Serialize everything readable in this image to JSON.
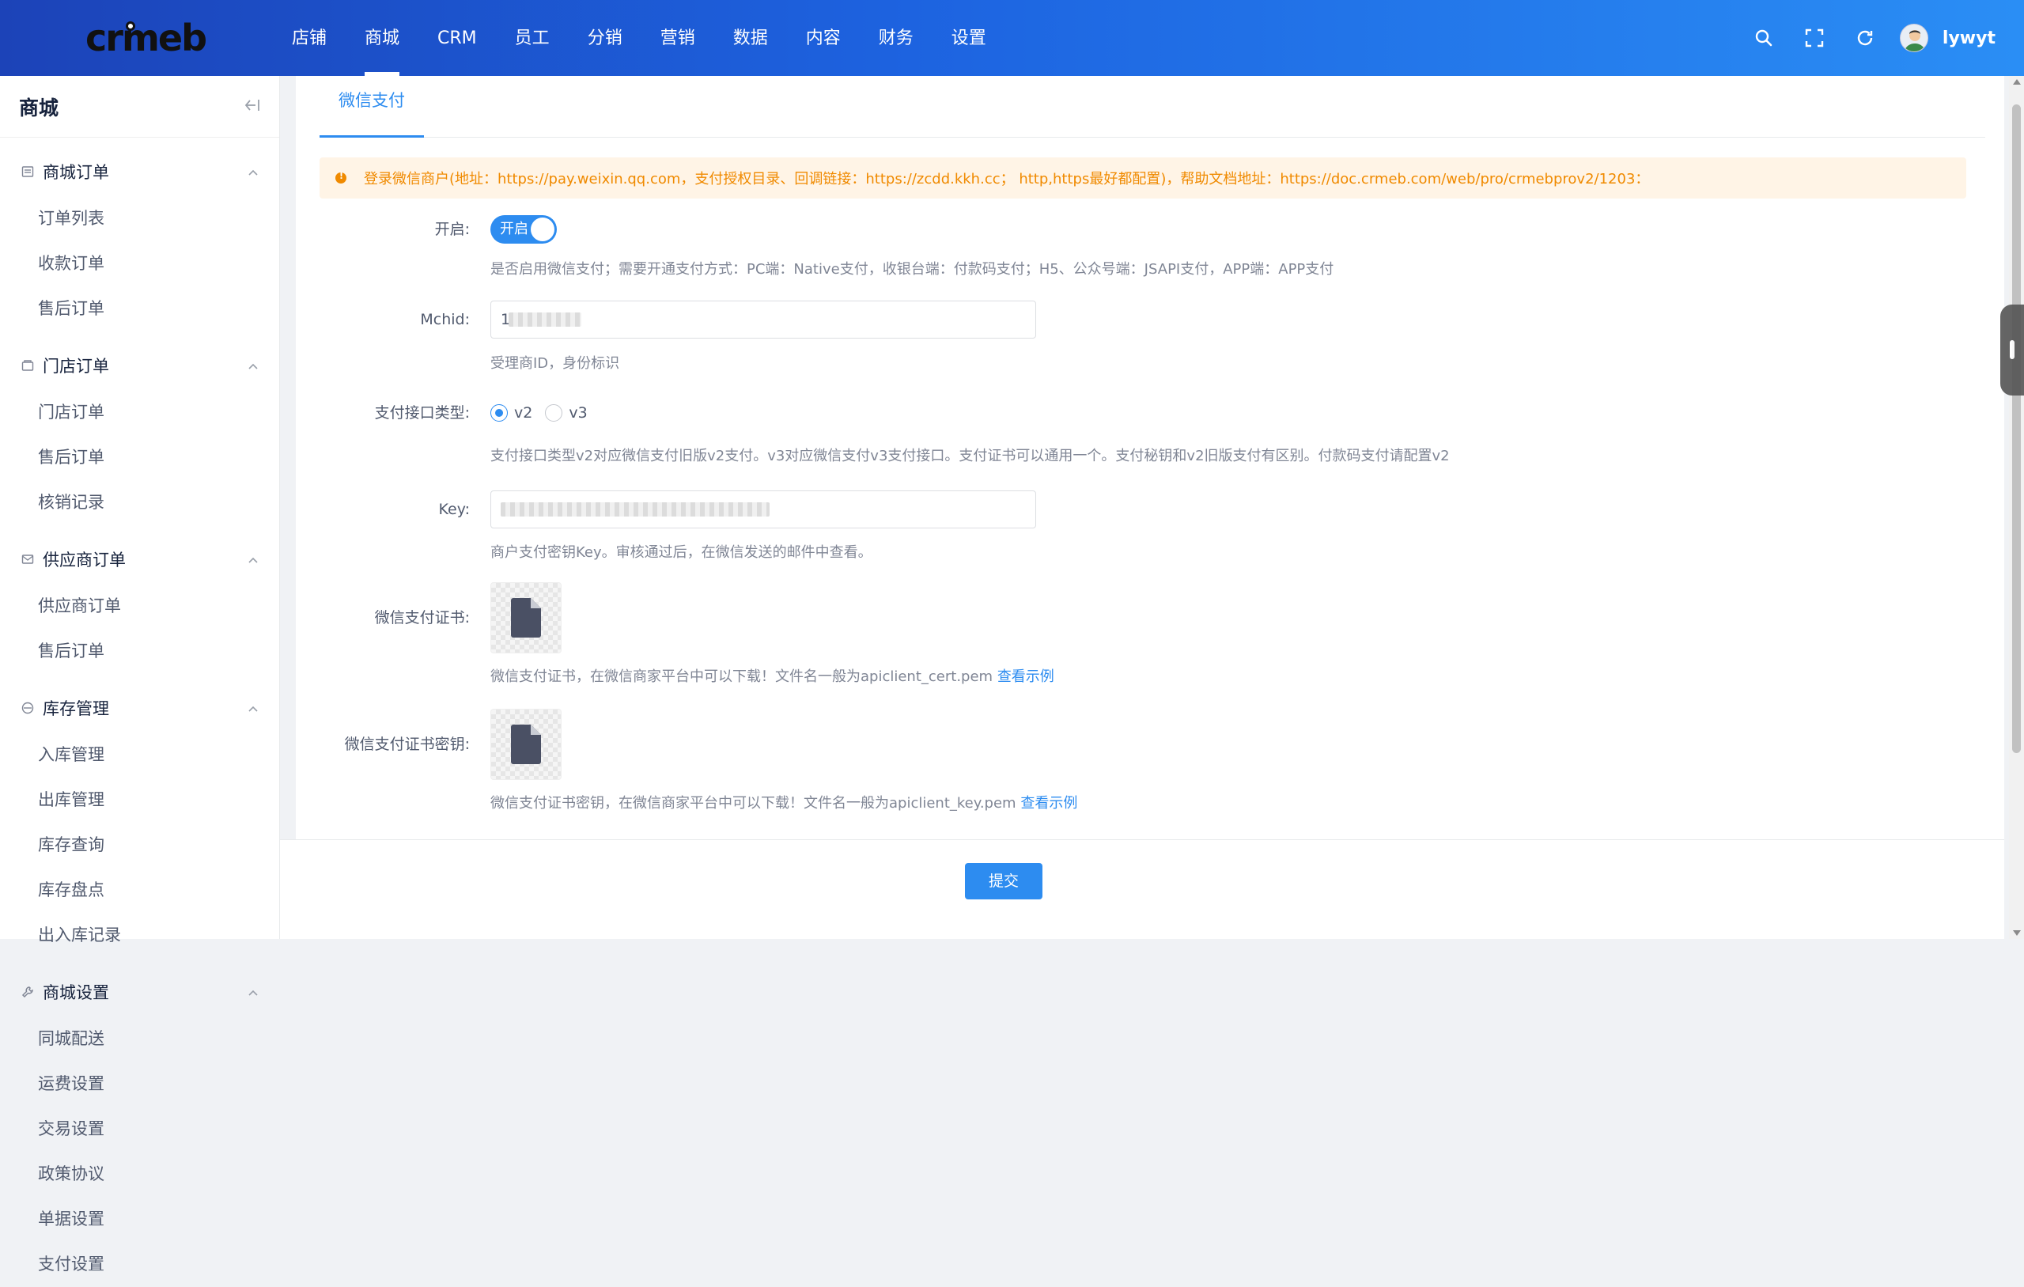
{
  "app": {
    "logo_text": "crmeb",
    "username": "lywyt"
  },
  "topnav": [
    {
      "label": "店铺"
    },
    {
      "label": "商城"
    },
    {
      "label": "CRM"
    },
    {
      "label": "员工"
    },
    {
      "label": "分销"
    },
    {
      "label": "营销"
    },
    {
      "label": "数据"
    },
    {
      "label": "内容"
    },
    {
      "label": "财务"
    },
    {
      "label": "设置"
    }
  ],
  "topnav_active_index": 1,
  "sidebar": {
    "title": "商城",
    "groups": [
      {
        "label": "商城订单",
        "icon": "order-icon",
        "items": [
          "订单列表",
          "收款订单",
          "售后订单"
        ]
      },
      {
        "label": "门店订单",
        "icon": "store-icon",
        "items": [
          "门店订单",
          "售后订单",
          "核销记录"
        ]
      },
      {
        "label": "供应商订单",
        "icon": "supplier-icon",
        "items": [
          "供应商订单",
          "售后订单"
        ]
      },
      {
        "label": "库存管理",
        "icon": "inventory-icon",
        "items": [
          "入库管理",
          "出库管理",
          "库存查询",
          "库存盘点",
          "出入库记录"
        ]
      },
      {
        "label": "商城设置",
        "icon": "wrench-icon",
        "items": [
          "同城配送",
          "运费设置",
          "交易设置",
          "政策协议",
          "单据设置",
          "支付设置"
        ]
      }
    ]
  },
  "tabs": {
    "active": "微信支付"
  },
  "alert": {
    "text": "登录微信商户(地址：https://pay.weixin.qq.com，支付授权目录、回调链接：https://zcdd.kkh.cc； http,https最好都配置)，帮助文档地址：https://doc.crmeb.com/web/pro/crmebprov2/1203："
  },
  "form": {
    "enable": {
      "label": "开启:",
      "switch_text": "开启",
      "help": "是否启用微信支付；需要开通支付方式：PC端：Native支付，收银台端：付款码支付；H5、公众号端：JSAPI支付，APP端：APP支付"
    },
    "mchid": {
      "label": "Mchid:",
      "value_prefix": "1",
      "help": "受理商ID，身份标识"
    },
    "api_type": {
      "label": "支付接口类型:",
      "options": [
        "v2",
        "v3"
      ],
      "selected": "v2",
      "help": "支付接口类型v2对应微信支付旧版v2支付。v3对应微信支付v3支付接口。支付证书可以通用一个。支付秘钥和v2旧版支付有区别。付款码支付请配置v2"
    },
    "key": {
      "label": "Key:",
      "help": "商户支付密钥Key。审核通过后，在微信发送的邮件中查看。"
    },
    "cert": {
      "label": "微信支付证书:",
      "help": "微信支付证书，在微信商家平台中可以下载！文件名一般为apiclient_cert.pem",
      "link": "查看示例"
    },
    "cert_key": {
      "label": "微信支付证书密钥:",
      "help": "微信支付证书密钥，在微信商家平台中可以下载！文件名一般为apiclient_key.pem",
      "link": "查看示例"
    }
  },
  "submit_label": "提交",
  "colors": {
    "primary": "#2d8cf0",
    "header_start": "#1c43b8",
    "header_end": "#2a8ef5",
    "warning": "#f08a00"
  }
}
